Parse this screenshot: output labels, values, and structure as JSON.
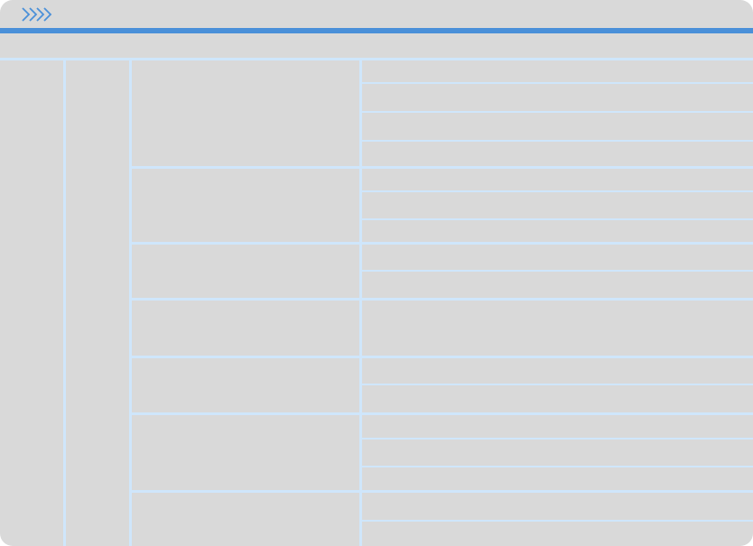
{
  "colors": {
    "background": "#d9d9d9",
    "accent": "#4a90d9",
    "grid_line": "#cfe6fb"
  },
  "header": {
    "icon": "chevrons-right-icon"
  },
  "table": {
    "columns": 4,
    "groups": [
      {
        "rows": 4
      },
      {
        "rows": 3
      },
      {
        "rows": 2
      },
      {
        "rows": 1
      },
      {
        "rows": 2
      },
      {
        "rows": 3
      },
      {
        "rows": 2
      }
    ]
  }
}
